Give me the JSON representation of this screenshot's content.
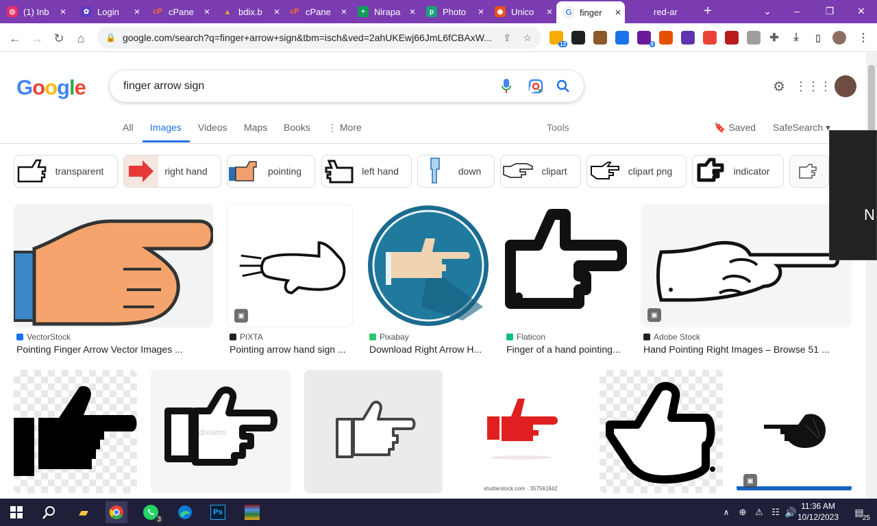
{
  "browser": {
    "tabs": [
      {
        "title": "(1) Inb",
        "color": "#e1306c",
        "glyph": "◎"
      },
      {
        "title": "Login",
        "color": "#5b3cc4",
        "glyph": "✿"
      },
      {
        "title": "cPane",
        "color": "#ff6c2c",
        "glyph": "cP"
      },
      {
        "title": "bdix.b",
        "color": "#b8860b",
        "glyph": "▲"
      },
      {
        "title": "cPane",
        "color": "#ff6c2c",
        "glyph": "cP"
      },
      {
        "title": "Nirapa",
        "color": "#0f9d58",
        "glyph": "+"
      },
      {
        "title": "Photo",
        "color": "#1aa37a",
        "glyph": "p"
      },
      {
        "title": "Unico",
        "color": "#e8501c",
        "glyph": "◉"
      },
      {
        "title": "finger",
        "color": "#4285f4",
        "glyph": "G"
      },
      {
        "title": "red-ar",
        "color": "#7a3cb0",
        "glyph": ""
      }
    ],
    "url": "google.com/search?q=finger+arrow+sign&tbm=isch&ved=2ahUKEwj66JmL6fCBAxW...",
    "extensions": [
      {
        "name": "ext-1-icon",
        "color": "#f9ab00",
        "badge": "13"
      },
      {
        "name": "ext-2-icon",
        "color": "#202124",
        "badge": ""
      },
      {
        "name": "ext-3-icon",
        "color": "#8b5a2b",
        "badge": ""
      },
      {
        "name": "ext-4-icon",
        "color": "#1a73e8",
        "badge": ""
      },
      {
        "name": "ext-5-icon",
        "color": "#6a1b9a",
        "badge": "9"
      },
      {
        "name": "ext-6-icon",
        "color": "#e65100",
        "badge": ""
      },
      {
        "name": "ext-7-icon",
        "color": "#5e35b1",
        "badge": ""
      },
      {
        "name": "ext-8-icon",
        "color": "#ea4335",
        "badge": ""
      },
      {
        "name": "ext-9-icon",
        "color": "#b71c1c",
        "badge": ""
      },
      {
        "name": "ext-10-icon",
        "color": "#9e9e9e",
        "badge": ""
      }
    ]
  },
  "google": {
    "logo": [
      "G",
      "o",
      "o",
      "g",
      "l",
      "e"
    ],
    "query": "finger arrow sign",
    "tabs": [
      "All",
      "Images",
      "Videos",
      "Maps",
      "Books",
      "More"
    ],
    "tools": "Tools",
    "saved": "Saved",
    "safesearch": "SafeSearch",
    "chips": [
      "transparent",
      "right hand",
      "pointing",
      "left hand",
      "down",
      "clipart",
      "clipart png",
      "indicator"
    ],
    "overlay_text": "N"
  },
  "results_row1": [
    {
      "source": "VectorStock",
      "caption": "Pointing Finger Arrow Vector Images ...",
      "source_color": "#1a73e8"
    },
    {
      "source": "PIXTA",
      "caption": "Pointing arrow hand sign ...",
      "source_color": "#202124"
    },
    {
      "source": "Pixabay",
      "caption": "Download Right Arrow H...",
      "source_color": "#2ec66d"
    },
    {
      "source": "Flaticon",
      "caption": "Finger of a hand pointing...",
      "source_color": "#0abf8a"
    },
    {
      "source": "Adobe Stock",
      "caption": "Hand Pointing Right Images – Browse 51 ...",
      "source_color": "#202124"
    }
  ],
  "results_row2": [
    {
      "watermark": ""
    },
    {
      "watermark": "dreams"
    },
    {
      "watermark": ""
    },
    {
      "watermark": "shutterstock.com · 357561842"
    },
    {
      "watermark": ""
    },
    {
      "watermark": ""
    }
  ],
  "taskbar": {
    "time": "11:36 AM",
    "date": "10/12/2023",
    "notifications": "25",
    "whatsapp_badge": "3"
  }
}
